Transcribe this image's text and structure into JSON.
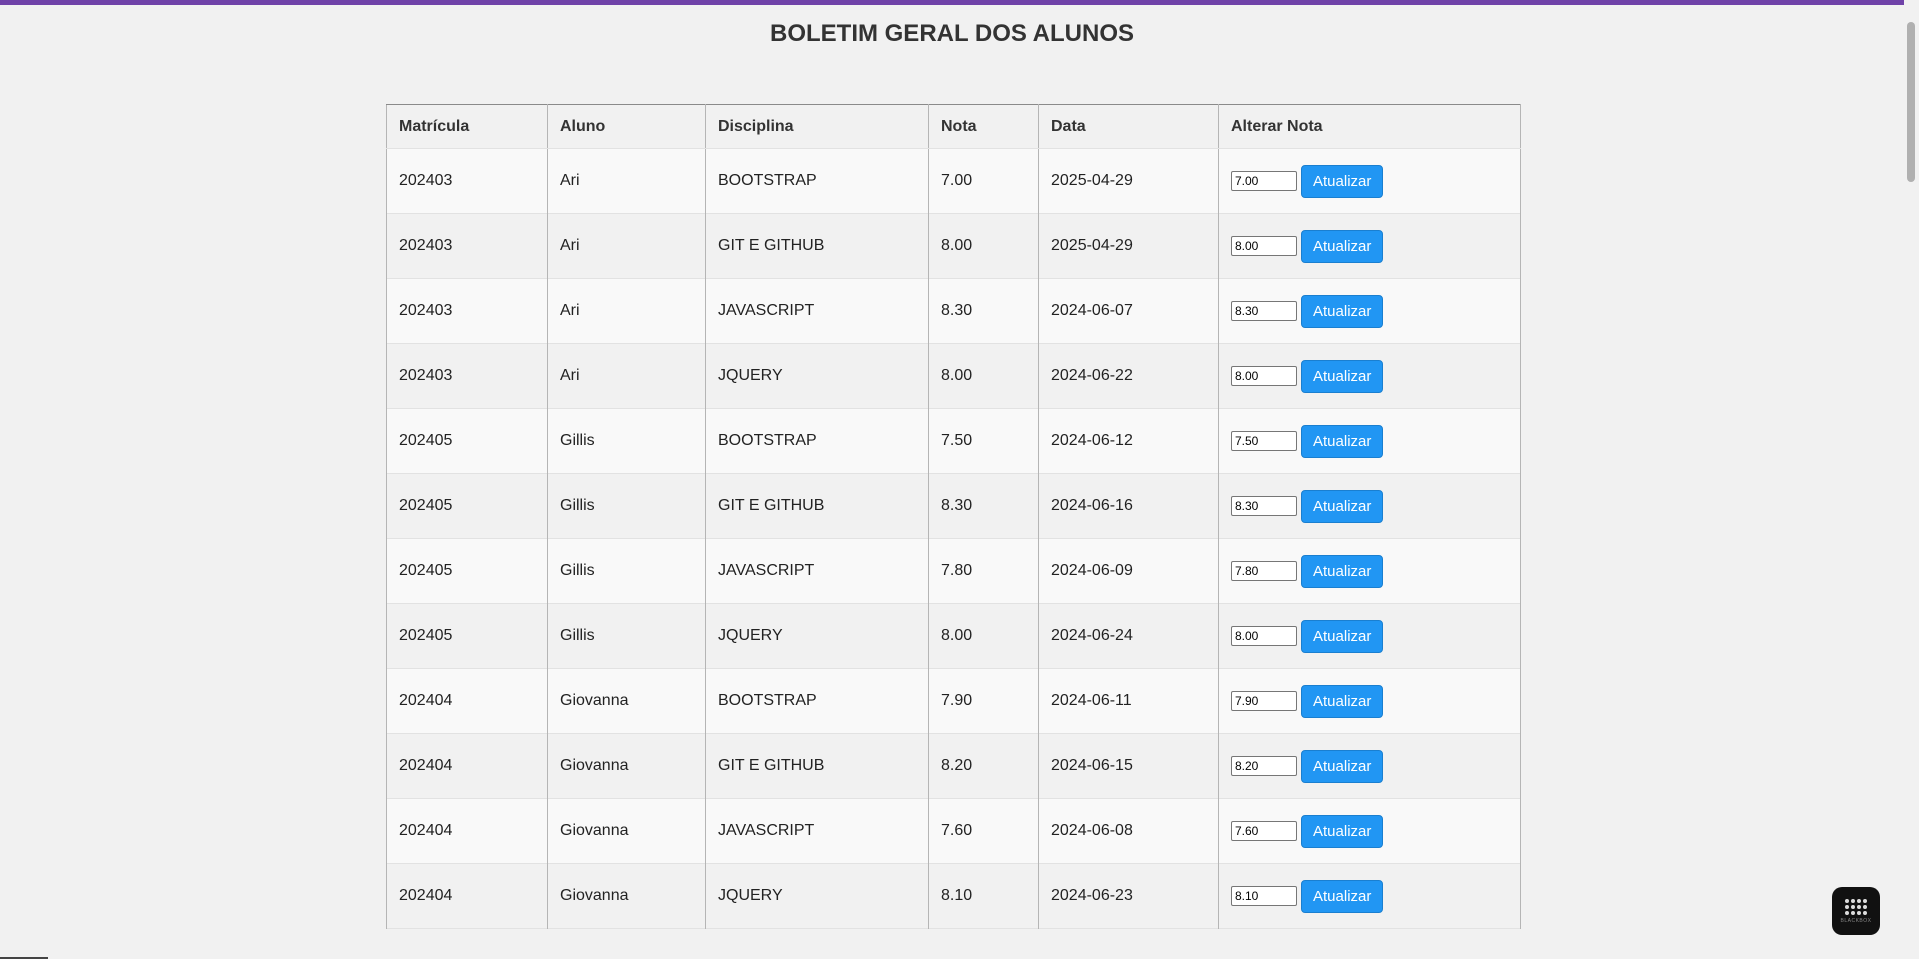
{
  "page": {
    "title": "BOLETIM GERAL DOS ALUNOS",
    "accent_color": "#6f42a8",
    "button_color": "#2196f3"
  },
  "table": {
    "headers": [
      "Matrícula",
      "Aluno",
      "Disciplina",
      "Nota",
      "Data",
      "Alterar Nota"
    ],
    "update_label": "Atualizar",
    "rows": [
      {
        "matricula": "202403",
        "aluno": "Ari",
        "disciplina": "BOOTSTRAP",
        "nota": "7.00",
        "data": "2025-04-29",
        "input": "7.00"
      },
      {
        "matricula": "202403",
        "aluno": "Ari",
        "disciplina": "GIT E GITHUB",
        "nota": "8.00",
        "data": "2025-04-29",
        "input": "8.00"
      },
      {
        "matricula": "202403",
        "aluno": "Ari",
        "disciplina": "JAVASCRIPT",
        "nota": "8.30",
        "data": "2024-06-07",
        "input": "8.30"
      },
      {
        "matricula": "202403",
        "aluno": "Ari",
        "disciplina": "JQUERY",
        "nota": "8.00",
        "data": "2024-06-22",
        "input": "8.00"
      },
      {
        "matricula": "202405",
        "aluno": "Gillis",
        "disciplina": "BOOTSTRAP",
        "nota": "7.50",
        "data": "2024-06-12",
        "input": "7.50"
      },
      {
        "matricula": "202405",
        "aluno": "Gillis",
        "disciplina": "GIT E GITHUB",
        "nota": "8.30",
        "data": "2024-06-16",
        "input": "8.30"
      },
      {
        "matricula": "202405",
        "aluno": "Gillis",
        "disciplina": "JAVASCRIPT",
        "nota": "7.80",
        "data": "2024-06-09",
        "input": "7.80"
      },
      {
        "matricula": "202405",
        "aluno": "Gillis",
        "disciplina": "JQUERY",
        "nota": "8.00",
        "data": "2024-06-24",
        "input": "8.00"
      },
      {
        "matricula": "202404",
        "aluno": "Giovanna",
        "disciplina": "BOOTSTRAP",
        "nota": "7.90",
        "data": "2024-06-11",
        "input": "7.90"
      },
      {
        "matricula": "202404",
        "aluno": "Giovanna",
        "disciplina": "GIT E GITHUB",
        "nota": "8.20",
        "data": "2024-06-15",
        "input": "8.20"
      },
      {
        "matricula": "202404",
        "aluno": "Giovanna",
        "disciplina": "JAVASCRIPT",
        "nota": "7.60",
        "data": "2024-06-08",
        "input": "7.60"
      },
      {
        "matricula": "202404",
        "aluno": "Giovanna",
        "disciplina": "JQUERY",
        "nota": "8.10",
        "data": "2024-06-23",
        "input": "8.10"
      }
    ]
  },
  "badge": {
    "label": "BLACKBOX",
    "icon": "blackbox-logo-icon"
  }
}
